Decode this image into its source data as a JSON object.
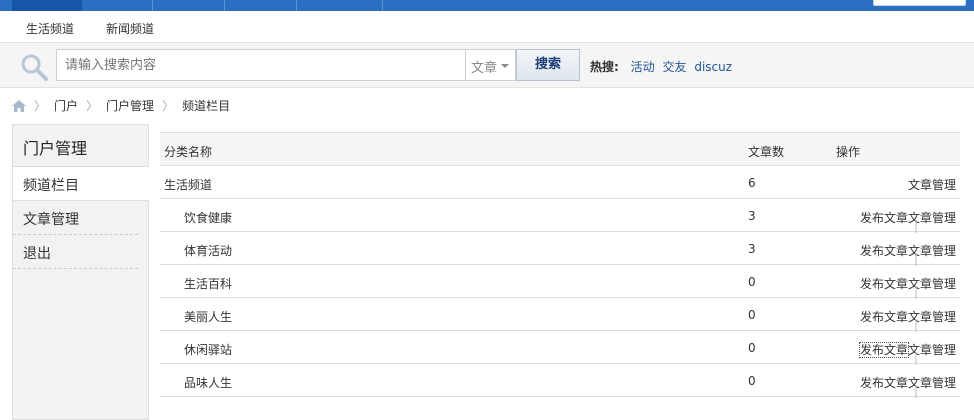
{
  "subnav": [
    "生活频道",
    "新闻频道"
  ],
  "search": {
    "placeholder": "请输入搜索内容",
    "type": "文章",
    "button": "搜索",
    "hot_label": "热搜:",
    "hot_links": [
      "活动",
      "交友",
      "discuz"
    ]
  },
  "breadcrumb": [
    "门户",
    "门户管理",
    "频道栏目"
  ],
  "sidebar": {
    "title": "门户管理",
    "items": [
      "频道栏目",
      "文章管理",
      "退出"
    ]
  },
  "table": {
    "headers": {
      "name": "分类名称",
      "count": "文章数",
      "ops": "操作"
    },
    "rows": [
      {
        "name": "生活频道",
        "count": "6",
        "publish": "",
        "manage": "文章管理"
      },
      {
        "name": "饮食健康",
        "count": "3",
        "publish": "发布文章",
        "manage": "文章管理"
      },
      {
        "name": "体育活动",
        "count": "3",
        "publish": "发布文章",
        "manage": "文章管理"
      },
      {
        "name": "生活百科",
        "count": "0",
        "publish": "发布文章",
        "manage": "文章管理"
      },
      {
        "name": "美丽人生",
        "count": "0",
        "publish": "发布文章",
        "manage": "文章管理"
      },
      {
        "name": "休闲驿站",
        "count": "0",
        "publish": "发布文章",
        "manage": "文章管理"
      },
      {
        "name": "品味人生",
        "count": "0",
        "publish": "发布文章",
        "manage": "文章管理"
      }
    ]
  }
}
